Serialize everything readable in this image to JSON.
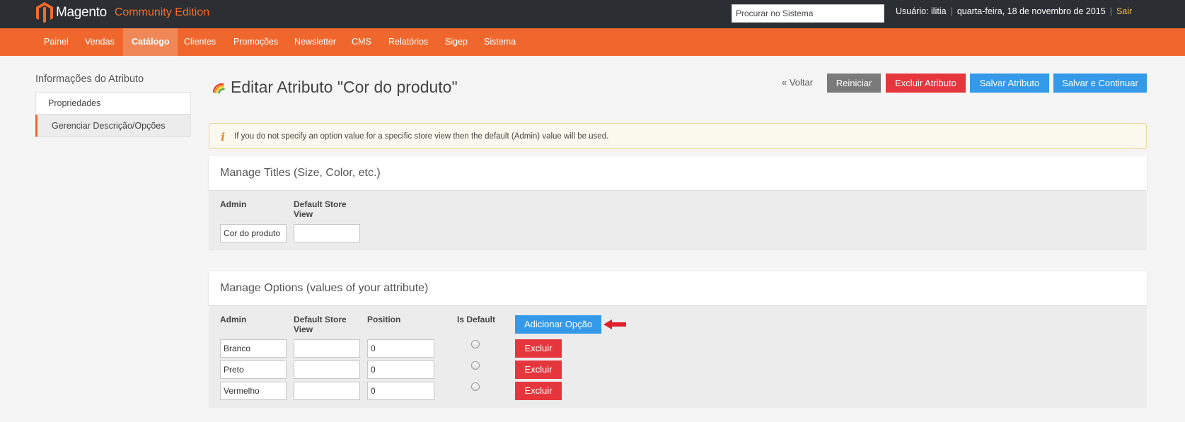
{
  "header": {
    "brand": "Magento",
    "edition": "Community Edition",
    "search_placeholder": "Procurar no Sistema",
    "user": "Usuário: ilitia",
    "date": "quarta-feira, 18 de novembro de 2015",
    "logout": "Sair"
  },
  "nav": [
    "Painel",
    "Vendas",
    "Catálogo",
    "Clientes",
    "Promoções",
    "Newsletter",
    "CMS",
    "Relatórios",
    "Sigep",
    "Sistema"
  ],
  "nav_active": "Catálogo",
  "sidebar": {
    "title": "Informações do Atributo",
    "tabs": [
      "Propriedades",
      "Gerenciar Descrição/Opções"
    ]
  },
  "page": {
    "title": "Editar Atributo \"Cor do produto\"",
    "back": "« Voltar",
    "reset": "Reiniciar",
    "delete": "Excluir Atributo",
    "save": "Salvar Atributo",
    "save_continue": "Salvar e Continuar"
  },
  "notice": "If you do not specify an option value for a specific store view then the default (Admin) value will be used.",
  "titles_section": {
    "heading": "Manage Titles (Size, Color, etc.)",
    "col_admin": "Admin",
    "col_store": "Default Store View",
    "admin_value": "Cor do produto",
    "store_value": ""
  },
  "options_section": {
    "heading": "Manage Options (values of your attribute)",
    "col_admin": "Admin",
    "col_store": "Default Store View",
    "col_position": "Position",
    "col_default": "Is Default",
    "add_button": "Adicionar Opção",
    "delete_label": "Excluir",
    "rows": [
      {
        "admin": "Branco",
        "store": "",
        "position": "0"
      },
      {
        "admin": "Preto",
        "store": "",
        "position": "0"
      },
      {
        "admin": "Vermelho",
        "store": "",
        "position": "0"
      }
    ]
  },
  "colors": {
    "header_bg": "#2b2e33",
    "nav_bg": "#f0672d",
    "primary_button": "#3399e8",
    "danger_button": "#e6363d"
  }
}
